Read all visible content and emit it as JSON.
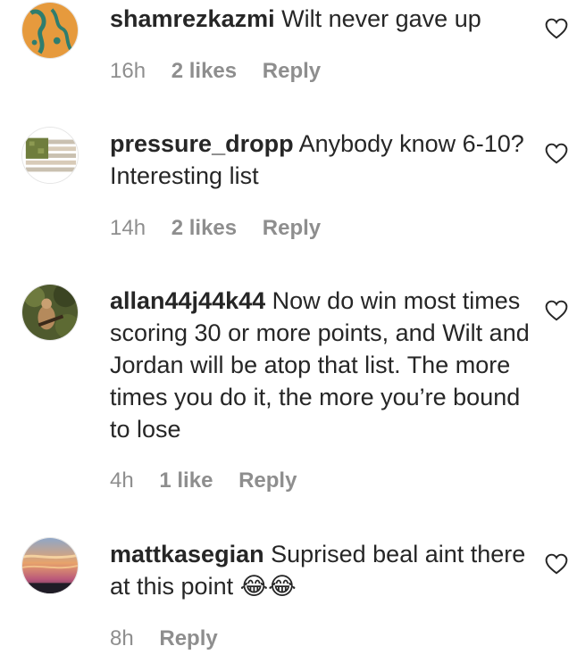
{
  "comments": [
    {
      "username": "shamrezkazmi",
      "text": "Wilt never gave up",
      "time": "16h",
      "likes": "2 likes",
      "reply": "Reply"
    },
    {
      "username": "pressure_dropp",
      "text": "Anybody know 6-10? Interesting list",
      "time": "14h",
      "likes": "2 likes",
      "reply": "Reply"
    },
    {
      "username": "allan44j44k44",
      "text": "Now do win most times scoring 30 or more points, and Wilt and Jordan will be atop that list. The more times you do it, the more you’re bound to lose",
      "time": "4h",
      "likes": "1 like",
      "reply": "Reply"
    },
    {
      "username": "mattkasegian",
      "text": "Suprised beal aint there at this point",
      "emoji": "😂😂",
      "time": "8h",
      "reply": "Reply"
    }
  ],
  "colors": {
    "text": "#262626",
    "meta": "#8e8e8e"
  },
  "icons": {
    "like": "heart-outline-icon"
  }
}
